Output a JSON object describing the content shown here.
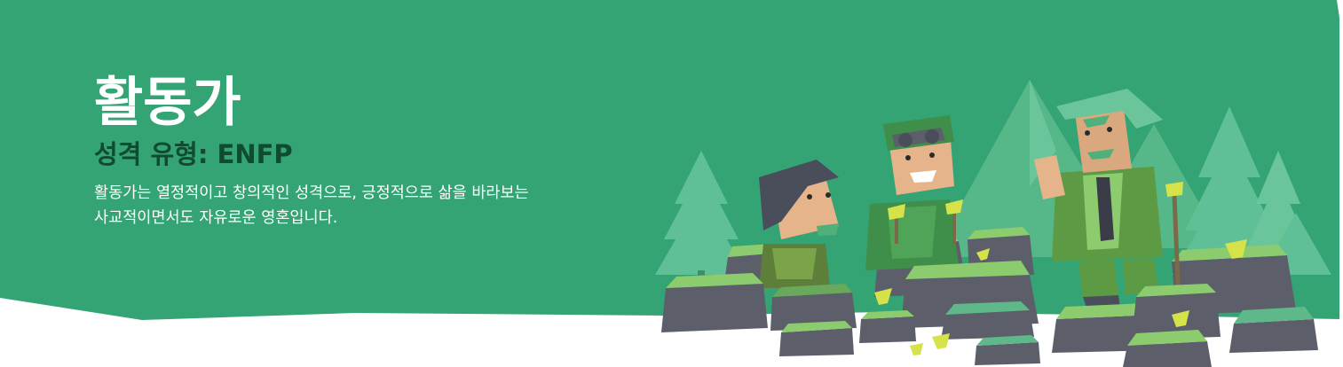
{
  "hero": {
    "title": "활동가",
    "subtitle": "성격 유형: ENFP",
    "description": "활동가는 열정적이고 창의적인 성격으로, 긍정적으로 삶을 바라보는 사교적이면서도 자유로운 영혼입니다."
  },
  "colors": {
    "background": "#34a474",
    "subtitle": "#0f4a31",
    "text": "#ffffff",
    "tree": "#5fc097",
    "rock": "#5c5e6a",
    "grass": "#8ccc6e"
  },
  "illustration": {
    "icons": [
      "tree-icon",
      "mountain-icon",
      "rock-block-icon",
      "person-icon",
      "flower-icon"
    ]
  }
}
